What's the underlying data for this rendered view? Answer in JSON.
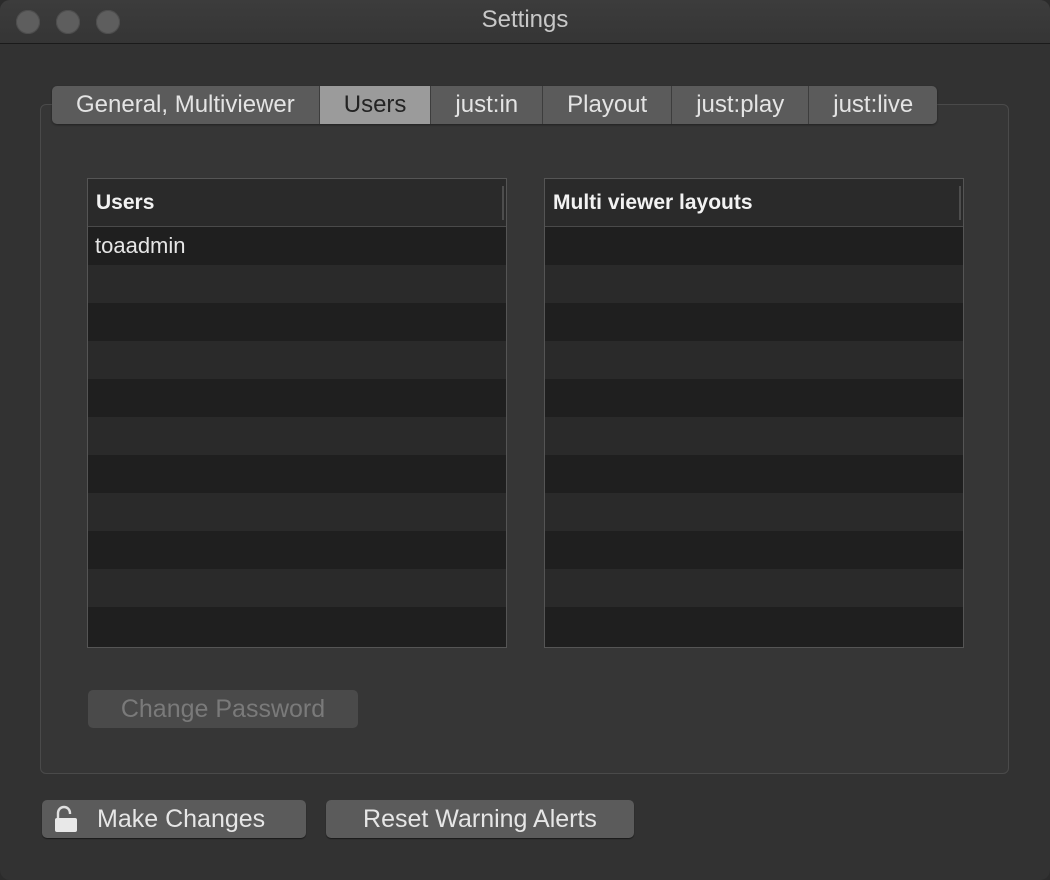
{
  "window": {
    "title": "Settings"
  },
  "tabs": [
    {
      "label": "General, Multiviewer",
      "selected": false
    },
    {
      "label": "Users",
      "selected": true
    },
    {
      "label": "just:in",
      "selected": false
    },
    {
      "label": "Playout",
      "selected": false
    },
    {
      "label": "just:play",
      "selected": false
    },
    {
      "label": "just:live",
      "selected": false
    }
  ],
  "users_table": {
    "header": "Users",
    "rows": [
      "toaadmin"
    ]
  },
  "layouts_table": {
    "header": "Multi viewer layouts",
    "rows": []
  },
  "buttons": {
    "change_password": "Change Password",
    "make_changes": "Make Changes",
    "reset_warning_alerts": "Reset Warning Alerts"
  },
  "icons": {
    "make_changes": "lock-open-icon"
  },
  "colors": {
    "window_bg": "#323232",
    "tab_selected": "#9b9b9b",
    "tab_normal": "#5b5b5b"
  }
}
